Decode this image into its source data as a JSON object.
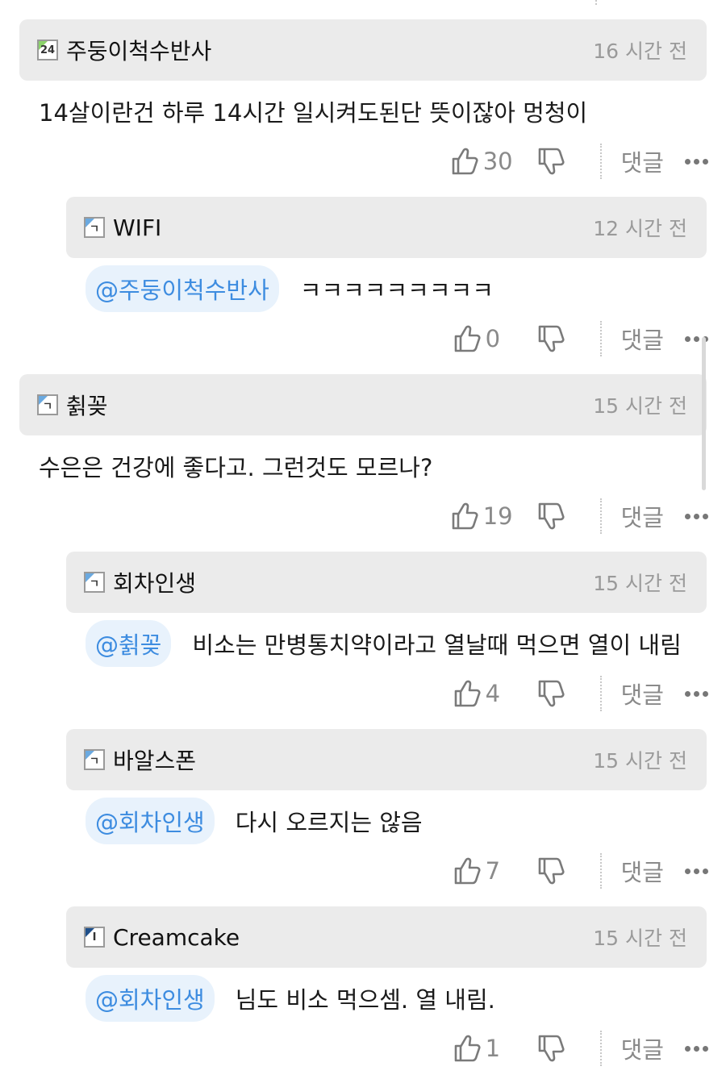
{
  "comments": [
    {
      "nickname": "주둥이척수반사",
      "level": "24",
      "time": "16 시간 전",
      "mention": "",
      "text": "14살이란건 하루 14시간 일시켜도된단 뜻이잖아 멍청이",
      "likes": "30",
      "reply_label": "댓글"
    },
    {
      "nickname": "WIFI",
      "level": "ㄱ",
      "time": "12 시간 전",
      "mention": "@주둥이척수반사",
      "text": "ㅋㅋㅋㅋㅋㅋㅋㅋㅋ",
      "likes": "0",
      "reply_label": "댓글"
    },
    {
      "nickname": "췱꽂",
      "level": "ㄱ",
      "time": "15 시간 전",
      "mention": "",
      "text": "수은은 건강에 좋다고. 그런것도 모르나?",
      "likes": "19",
      "reply_label": "댓글"
    },
    {
      "nickname": "회차인생",
      "level": "ㄱ",
      "time": "15 시간 전",
      "mention": "@췱꽂",
      "text": "비소는 만병통치약이라고 열날때 먹으면 열이 내림",
      "likes": "4",
      "reply_label": "댓글"
    },
    {
      "nickname": "바알스폰",
      "level": "ㄱ",
      "time": "15 시간 전",
      "mention": "@회차인생",
      "text": "다시 오르지는 않음",
      "likes": "7",
      "reply_label": "댓글"
    },
    {
      "nickname": "Creamcake",
      "level": "I",
      "time": "15 시간 전",
      "mention": "@회차인생",
      "text": "님도 비소 먹으셈. 열 내림.",
      "likes": "1",
      "reply_label": "댓글"
    }
  ],
  "colors": {
    "header_bg": "#ebebeb",
    "mention_text": "#3d8ce0",
    "mention_bg": "#e8f2fc",
    "meta": "#9a9a9a"
  },
  "icons": {
    "like": "thumbs-up-icon",
    "dislike": "thumbs-down-icon",
    "more": "more-dots-icon"
  }
}
